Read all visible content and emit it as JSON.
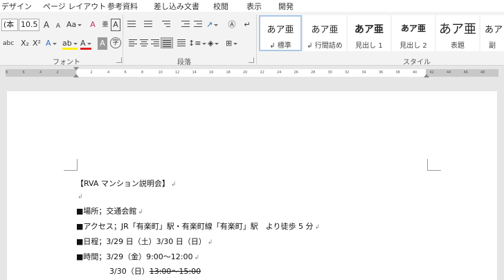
{
  "menu_tabs": [
    "デザイン",
    "ページ レイアウト",
    "参考資料",
    "差し込み文書",
    "校閲",
    "表示",
    "開発"
  ],
  "font_group": {
    "font_name": "(本",
    "font_size": "10.5",
    "grow_label": "A",
    "shrink_label": "A",
    "case_label": "Aa",
    "clear_label": "A",
    "ruby_label": "亜",
    "border_label": "A",
    "strike_label": "abc",
    "subscript_label": "X₂",
    "superscript_label": "X²",
    "effect_label": "A",
    "highlight_label": "ab",
    "color_label": "A",
    "shade_label": "A",
    "circle_label": "字",
    "label": "フォント"
  },
  "paragraph_group": {
    "label": "段落"
  },
  "styles_group": {
    "label": "スタイル",
    "items": [
      {
        "sample": "あア亜",
        "name": "↲ 標準"
      },
      {
        "sample": "あア亜",
        "name": "↲ 行間詰め"
      },
      {
        "sample": "あア亜",
        "name": "見出し 1"
      },
      {
        "sample": "あア亜",
        "name": "見出し 2"
      },
      {
        "sample": "あア亜",
        "name": "表題"
      },
      {
        "sample": "あア",
        "name": "副"
      }
    ]
  },
  "ruler_ticks": [
    "8",
    "6",
    "4",
    "2",
    "",
    "2",
    "4",
    "6",
    "8",
    "10",
    "12",
    "14",
    "16",
    "18",
    "20",
    "22",
    "24",
    "26",
    "28",
    "30",
    "32",
    "34",
    "36",
    "38",
    "40",
    "42",
    "44",
    "46",
    "48"
  ],
  "document": {
    "title": "【RVA マンション説明会】",
    "blank_mark": "↲",
    "lines": [
      "■場所；交通会館",
      "■アクセス；JR「有楽町」駅・有楽町線「有楽町」駅　より徒歩 5 分",
      "■日程；3/29 日（土）3/30 日（日）",
      "■時間；3/29（金）9:00～12:00"
    ],
    "last_line_prefix": "3/30（日）",
    "last_line_struck": "13:00～15:00"
  }
}
